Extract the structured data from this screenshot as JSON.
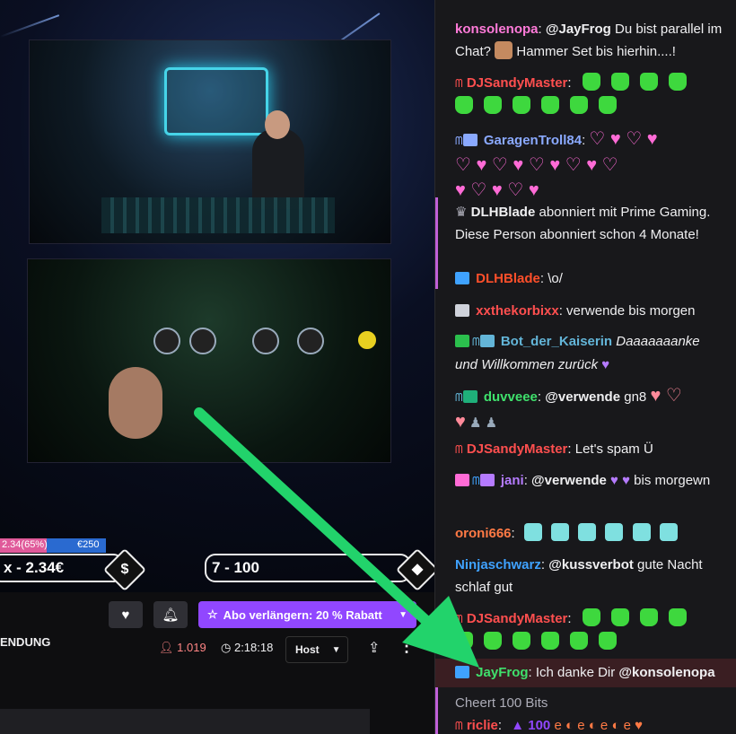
{
  "overlay": {
    "bar_left_text": "2.34(65%)",
    "bar_right_text": "€250",
    "pill_left_text": "x - 2.34€",
    "pill_right_text": "7 - 100",
    "dollar_glyph": "$"
  },
  "under_player": {
    "title_fragment": "ENDUNG",
    "abo_label": "Abo verlängern: 20 % Rabatt",
    "viewers": "1.019",
    "uptime": "2:18:18",
    "host_label": "Host"
  },
  "chat": {
    "messages": [
      {
        "user": "konsolenopa",
        "sep": ":",
        "mention": "@JayFrog",
        "text": " Du bist parallel im Chat? ",
        "text2": " Hammer Set bis hierhin....!",
        "user_color": "#ff7ad9"
      },
      {
        "user": "DJSandyMaster",
        "sep": ":",
        "user_color": "#ff4f4f"
      },
      {
        "user": "GaragenTroll84",
        "sep": ":",
        "user_color": "#8aa9ff"
      },
      {
        "user": "DLHBlade",
        "text": " abonniert mit Prime Gaming. Diese Person abonniert schon 4 Monate!"
      },
      {
        "user": "DLHBlade",
        "sep": ":",
        "text": " \\o/",
        "user_color": "#ff4f2a"
      },
      {
        "user": "xxthekorbixx",
        "sep": ":",
        "text": " verwende bis morgen",
        "user_color": "#ff4f4f"
      },
      {
        "user": "Bot_der_Kaiserin",
        "text": " Daaaaaaanke und Willkommen zurück",
        "user_color": "#63b5d8"
      },
      {
        "user": "duvveee",
        "sep": ":",
        "mention": "@verwende",
        "text": " gn8",
        "user_color": "#3fe06c"
      },
      {
        "user": "DJSandyMaster",
        "sep": ":",
        "text": " Let's spam Ü",
        "user_color": "#ff4f4f"
      },
      {
        "user": "jani",
        "sep": ":",
        "mention": "@verwende",
        "text": " bis morgewn",
        "user_color": "#b57bff"
      },
      {
        "user": "oroni666",
        "sep": ":",
        "user_color": "#ff7a45"
      },
      {
        "user": "Ninjaschwarz",
        "sep": ":",
        "mention": "@kussverbot",
        "text": " gute Nacht schlaf gut",
        "user_color": "#3fa2ff"
      },
      {
        "user": "DJSandyMaster",
        "sep": ":",
        "user_color": "#ff4f4f"
      },
      {
        "user": "JayFrog",
        "sep": ":",
        "text": " Ich danke Dir ",
        "mention": "@konsolenopa",
        "user_color": "#3fe06c"
      },
      {
        "text": "Cheert 100 Bits"
      },
      {
        "user": "riclie",
        "sep": ":",
        "text": " 100",
        "user_color": "#ff4f4f"
      }
    ]
  },
  "colors": {
    "accent": "#9147ff",
    "arrow": "#22d36b",
    "viewer_red": "#ff8585"
  }
}
